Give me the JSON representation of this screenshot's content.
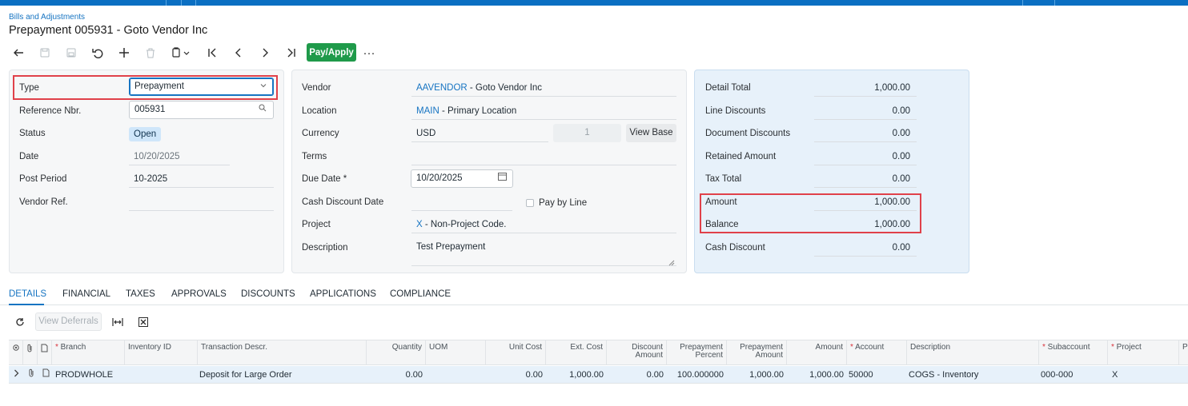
{
  "breadcrumb": "Bills and Adjustments",
  "title": "Prepayment 005931 - Goto Vendor Inc",
  "toolbar": {
    "pay_apply_label": "Pay/Apply",
    "more_label": "···"
  },
  "header_left": {
    "type_label": "Type",
    "type_value": "Prepayment",
    "ref_label": "Reference Nbr.",
    "ref_value": "005931",
    "status_label": "Status",
    "status_value": "Open",
    "date_label": "Date",
    "date_value": "10/20/2025",
    "post_period_label": "Post Period",
    "post_period_value": "10-2025",
    "vendor_ref_label": "Vendor Ref.",
    "vendor_ref_value": ""
  },
  "header_mid": {
    "vendor_label": "Vendor",
    "vendor_code": "AAVENDOR",
    "vendor_name": " - Goto Vendor Inc",
    "location_label": "Location",
    "location_code": "MAIN",
    "location_name": " - Primary Location",
    "currency_label": "Currency",
    "currency_value": "USD",
    "currency_rate": "1",
    "view_base_label": "View Base",
    "terms_label": "Terms",
    "terms_value": "",
    "due_date_label": "Due Date *",
    "due_date_value": "10/20/2025",
    "cash_discount_date_label": "Cash Discount Date",
    "pay_by_line_label": "Pay by Line",
    "project_label": "Project",
    "project_code": "X",
    "project_name": " - Non-Project Code.",
    "description_label": "Description",
    "description_value": "Test Prepayment"
  },
  "summary": {
    "detail_total_label": "Detail Total",
    "detail_total": "1,000.00",
    "line_discounts_label": "Line Discounts",
    "line_discounts": "0.00",
    "document_discounts_label": "Document Discounts",
    "document_discounts": "0.00",
    "retained_amount_label": "Retained Amount",
    "retained_amount": "0.00",
    "tax_total_label": "Tax Total",
    "tax_total": "0.00",
    "amount_label": "Amount",
    "amount": "1,000.00",
    "balance_label": "Balance",
    "balance": "1,000.00",
    "cash_discount_label": "Cash Discount",
    "cash_discount": "0.00"
  },
  "tabs": [
    "DETAILS",
    "FINANCIAL",
    "TAXES",
    "APPROVALS",
    "DISCOUNTS",
    "APPLICATIONS",
    "COMPLIANCE"
  ],
  "grid_toolbar": {
    "view_deferrals_label": "View Deferrals"
  },
  "grid": {
    "columns": {
      "branch": "Branch",
      "inventory_id": "Inventory ID",
      "transaction_descr": "Transaction Descr.",
      "quantity": "Quantity",
      "uom": "UOM",
      "unit_cost": "Unit Cost",
      "ext_cost": "Ext. Cost",
      "discount_amount_1": "Discount",
      "discount_amount_2": "Amount",
      "prepayment_percent_1": "Prepayment",
      "prepayment_percent_2": "Percent",
      "prepayment_amount_1": "Prepayment",
      "prepayment_amount_2": "Amount",
      "amount": "Amount",
      "account": "Account",
      "description": "Description",
      "subaccount": "Subaccount",
      "project": "Project",
      "extra": "P"
    },
    "row": {
      "branch": "PRODWHOLE",
      "inventory_id": "",
      "transaction_descr": "Deposit for Large Order",
      "quantity": "0.00",
      "uom": "",
      "unit_cost": "0.00",
      "ext_cost": "1,000.00",
      "discount_amount": "0.00",
      "prepayment_percent": "100.000000",
      "prepayment_amount": "1,000.00",
      "amount": "1,000.00",
      "account": "50000",
      "description": "COGS - Inventory",
      "subaccount": "000-000",
      "project": "X"
    }
  }
}
